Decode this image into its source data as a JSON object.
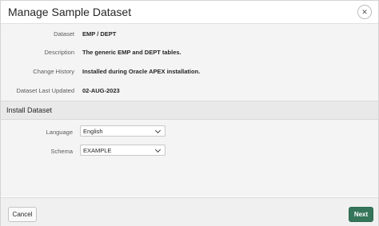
{
  "dialog": {
    "title": "Manage Sample Dataset",
    "close_icon": "close-icon"
  },
  "info": [
    {
      "label": "Dataset",
      "value": "EMP / DEPT"
    },
    {
      "label": "Description",
      "value": "The generic EMP and DEPT tables."
    },
    {
      "label": "Change History",
      "value": "Installed during Oracle APEX installation."
    },
    {
      "label": "Dataset Last Updated",
      "value": "02-AUG-2023"
    }
  ],
  "install": {
    "heading": "Install Dataset",
    "language": {
      "label": "Language",
      "value": "English"
    },
    "schema": {
      "label": "Schema",
      "value": "EXAMPLE"
    }
  },
  "footer": {
    "cancel_label": "Cancel",
    "next_label": "Next"
  },
  "colors": {
    "primary": "#35755a"
  }
}
